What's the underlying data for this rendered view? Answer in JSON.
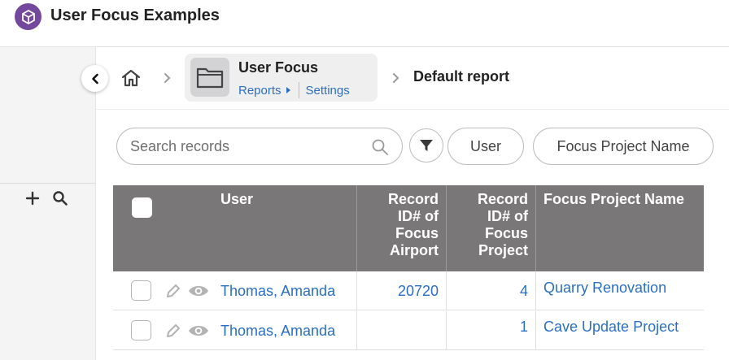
{
  "app": {
    "title": "User Focus Examples",
    "logo_icon": "cube-icon",
    "accent": "#74489d"
  },
  "breadcrumb": {
    "table_name": "User Focus",
    "reports_label": "Reports",
    "settings_label": "Settings",
    "report_name": "Default report"
  },
  "filters": {
    "search_placeholder": "Search records",
    "pills": [
      "User",
      "Focus Project Name"
    ]
  },
  "table": {
    "columns": [
      "User",
      "Record ID# of Focus Airport",
      "Record ID# of Focus Project",
      "Focus Project Name"
    ],
    "rows": [
      {
        "user": "Thomas, Amanda",
        "airport_id": "20720",
        "project_id": "4",
        "project_name": "Quarry Renovation"
      },
      {
        "user": "Thomas, Amanda",
        "airport_id": "",
        "project_id": "1",
        "project_name": "Cave Update Project"
      }
    ]
  },
  "colors": {
    "header_bg": "#7a7779",
    "link": "#2a6fc4",
    "rail_bg": "#f4f4f5"
  }
}
